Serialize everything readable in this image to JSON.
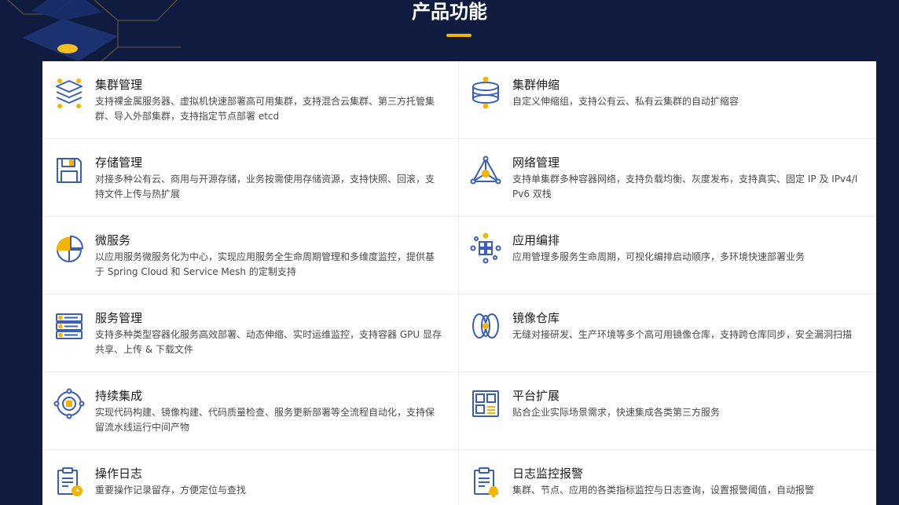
{
  "section": {
    "title": "产品功能"
  },
  "colors": {
    "background": "#0f1c3f",
    "accent": "#f4b400",
    "icon_blue": "#3a5fb8",
    "icon_orange": "#f4b400"
  },
  "features": [
    {
      "title": "集群管理",
      "desc": "支持裸金属服务器、虚拟机快速部署高可用集群，支持混合云集群、第三方托管集群、导入外部集群，支持指定节点部署 etcd",
      "icon": "stack-layers-icon"
    },
    {
      "title": "集群伸缩",
      "desc": "自定义伸缩组，支持公有云、私有云集群的自动扩缩容",
      "icon": "cylinder-icon"
    },
    {
      "title": "存储管理",
      "desc": "对接多种公有云、商用与开源存储，业务按需使用存储资源，支持快照、回滚，支持文件上传与热扩展",
      "icon": "floppy-disk-icon"
    },
    {
      "title": "网络管理",
      "desc": "支持单集群多种容器网络，支持负载均衡、灰度发布，支持真实、固定 IP 及 IPv4/IPv6 双栈",
      "icon": "network-triangle-icon"
    },
    {
      "title": "微服务",
      "desc": "以应用服务微服务化为中心，实现应用服务全生命周期管理和多维度监控，提供基于 Spring Cloud 和 Service Mesh 的定制支持",
      "icon": "pie-segments-icon"
    },
    {
      "title": "应用编排",
      "desc": "应用管理多服务生命周期，可视化编排启动顺序，多环境快速部署业务",
      "icon": "grid-nodes-icon"
    },
    {
      "title": "服务管理",
      "desc": "支持多种类型容器化服务高效部署、动态伸缩、实时运维监控，支持容器 GPU 显存共享、上传 & 下载文件",
      "icon": "server-rack-icon"
    },
    {
      "title": "镜像仓库",
      "desc": "无缝对接研发、生产环境等多个高可用镜像仓库，支持跨仓库同步，安全漏洞扫描",
      "icon": "rings-icon"
    },
    {
      "title": "持续集成",
      "desc": "实现代码构建、镜像构建、代码质量检查、服务更新部署等全流程自动化，支持保留流水线运行中间产物",
      "icon": "target-cycle-icon"
    },
    {
      "title": "平台扩展",
      "desc": "贴合企业实际场景需求，快速集成各类第三方服务",
      "icon": "layout-blocks-icon"
    },
    {
      "title": "操作日志",
      "desc": "重要操作记录留存，方便定位与查找",
      "icon": "clipboard-clock-icon"
    },
    {
      "title": "日志监控报警",
      "desc": "集群、节点、应用的各类指标监控与日志查询，设置报警阈值，自动报警",
      "icon": "clipboard-bell-icon"
    }
  ]
}
